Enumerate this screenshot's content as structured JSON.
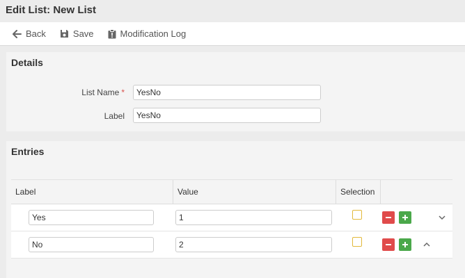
{
  "header": {
    "title": "Edit List: New List"
  },
  "toolbar": {
    "back_label": "Back",
    "save_label": "Save",
    "modlog_label": "Modification Log"
  },
  "details": {
    "title": "Details",
    "list_name_label": "List Name",
    "required_mark": "*",
    "list_name_value": "YesNo",
    "label_label": "Label",
    "label_value": "YesNo"
  },
  "entries": {
    "title": "Entries",
    "columns": {
      "label": "Label",
      "value": "Value",
      "selection": "Selection"
    },
    "rows": [
      {
        "label": "Yes",
        "value": "1",
        "selected": false
      },
      {
        "label": "No",
        "value": "2",
        "selected": false
      }
    ]
  },
  "colors": {
    "remove_button": "#e04b4b",
    "add_button": "#4aa84a",
    "checkbox_border": "#e2b93b",
    "required_mark": "#d9534f"
  },
  "icons": {
    "back": "arrow-left-icon",
    "save": "floppy-disk-icon",
    "modlog": "clipboard-icon",
    "remove": "minus-icon",
    "add": "plus-icon",
    "move_down": "chevron-down-icon",
    "move_up": "chevron-up-icon"
  }
}
